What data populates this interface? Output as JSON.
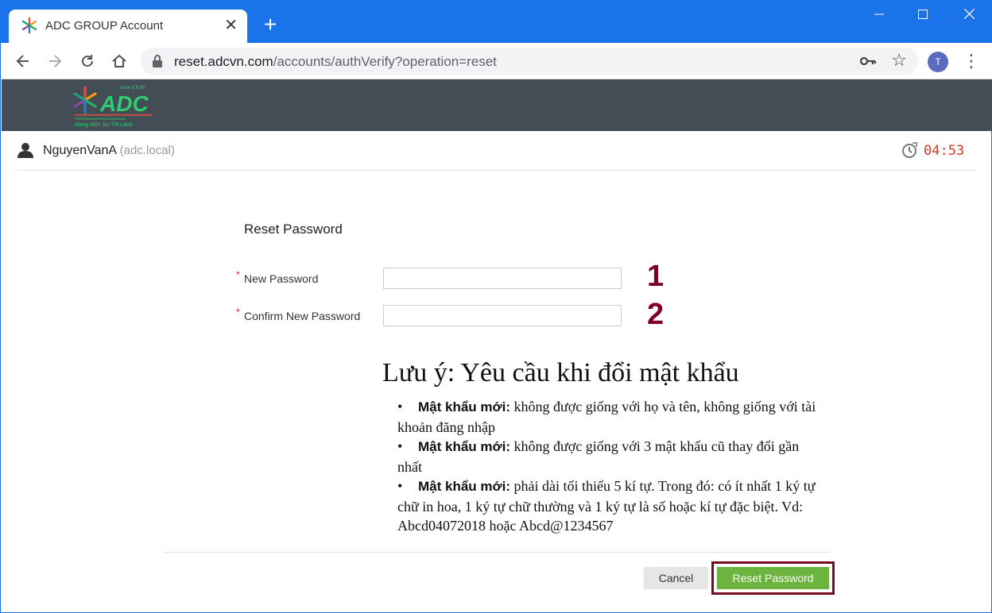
{
  "browser": {
    "tab_title": "ADC GROUP Account",
    "tab_close": "✕",
    "new_tab": "+",
    "url_host": "reset.adcvn.com",
    "url_path": "/accounts/authVerify?operation=reset",
    "profile_initial": "T",
    "accent_color": "#1a73e8"
  },
  "header": {
    "logo_tagline_top": "since 9.9.99",
    "logo_text": "ADC",
    "logo_subtitle": "Allied Development Corporation",
    "logo_slogan": "Mang Đến Sự Tốt Lành",
    "background_color": "#434d55"
  },
  "user": {
    "name": "NguyenVanA",
    "domain": "(adc.local)",
    "timer": "04:53"
  },
  "form": {
    "title": "Reset Password",
    "new_password_label": "New Password",
    "confirm_password_label": "Confirm New Password",
    "new_password_value": "",
    "confirm_password_value": "",
    "marker_1": "1",
    "marker_2": "2",
    "required_mark": "*"
  },
  "note": {
    "title": "Lưu ý: Yêu cầu khi đổi mật khẩu",
    "items": [
      {
        "label": "Mật khẩu mới:",
        "text": " không được giống với họ và tên, không giống với tài khoản đăng nhập"
      },
      {
        "label": "Mật khẩu mới:",
        "text": " không được giống với 3 mật khẩu cũ thay đổi gần nhất"
      },
      {
        "label": "Mật khẩu mới:",
        "text": " phải dài tối thiểu 5 kí tự. Trong đó: có ít nhất 1 ký tự chữ in hoa, 1 ký tự chữ thường và 1 ký tự là số hoặc kí tự đặc biệt. Vd: Abcd04072018 hoặc Abcd@1234567"
      }
    ],
    "bullet": "•"
  },
  "buttons": {
    "cancel": "Cancel",
    "reset": "Reset Password",
    "reset_color": "#6db33f",
    "highlight_color": "#7a0a20"
  }
}
